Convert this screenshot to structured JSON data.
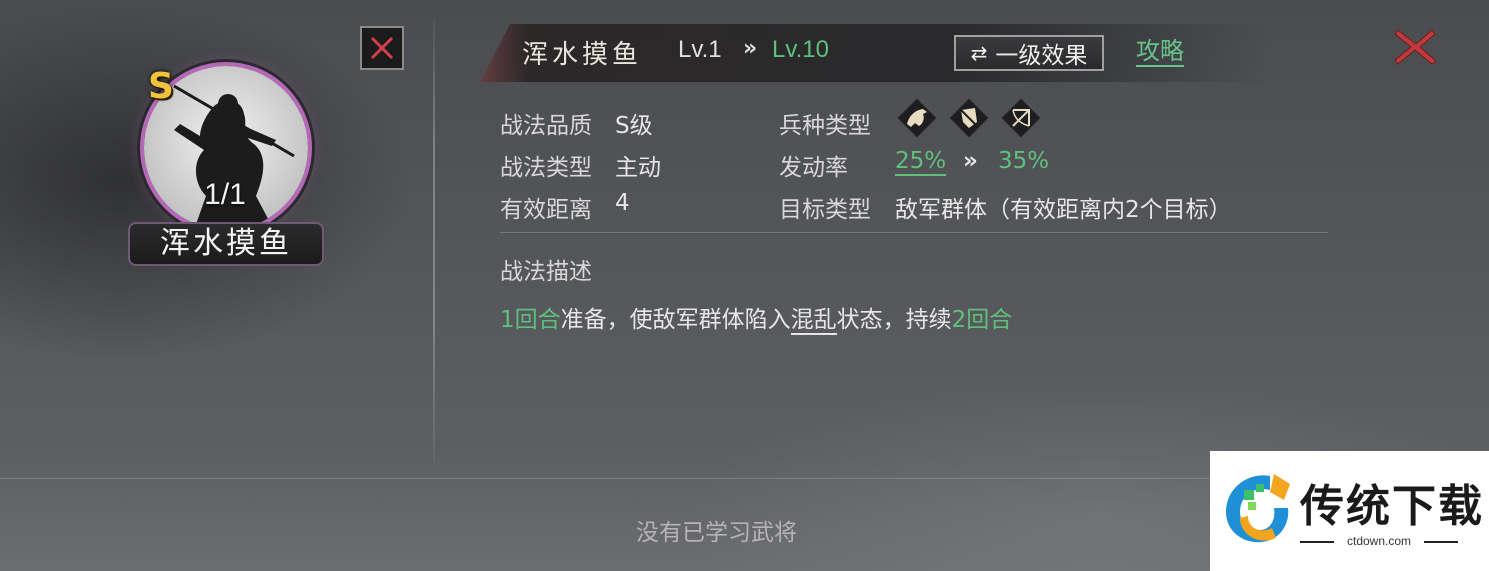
{
  "card": {
    "grade": "S",
    "count": "1/1",
    "name": "浑水摸鱼"
  },
  "header": {
    "name": "浑水摸鱼",
    "level_from": "Lv.1",
    "arrow": "»",
    "level_to": "Lv.10",
    "effect_button": "一级效果",
    "guide_link": "攻略"
  },
  "attributes": {
    "quality_label": "战法品质",
    "quality_value": "S级",
    "type_label": "战法类型",
    "type_value": "主动",
    "range_label": "有效距离",
    "range_value": "4",
    "troop_label": "兵种类型",
    "troop_icons": [
      "cavalry-icon",
      "shield-icon",
      "bow-icon"
    ],
    "rate_label": "发动率",
    "rate_from": "25%",
    "rate_arrow": "»",
    "rate_to": "35%",
    "target_label": "目标类型",
    "target_value": "敌军群体（有效距离内2个目标）"
  },
  "description": {
    "title": "战法描述",
    "parts": [
      "1回合",
      "准备，使敌军群体陷入",
      "混乱",
      "状态，持续",
      "2回合"
    ]
  },
  "footer": {
    "empty_note": "没有已学习武将"
  },
  "watermark": {
    "title": "传统下载",
    "url": "ctdown.com"
  },
  "colors": {
    "accent_green": "#5fc07c",
    "close_red": "#c0393b",
    "grade_gold": "#f0c33a",
    "ring_purple": "#b567b8"
  }
}
